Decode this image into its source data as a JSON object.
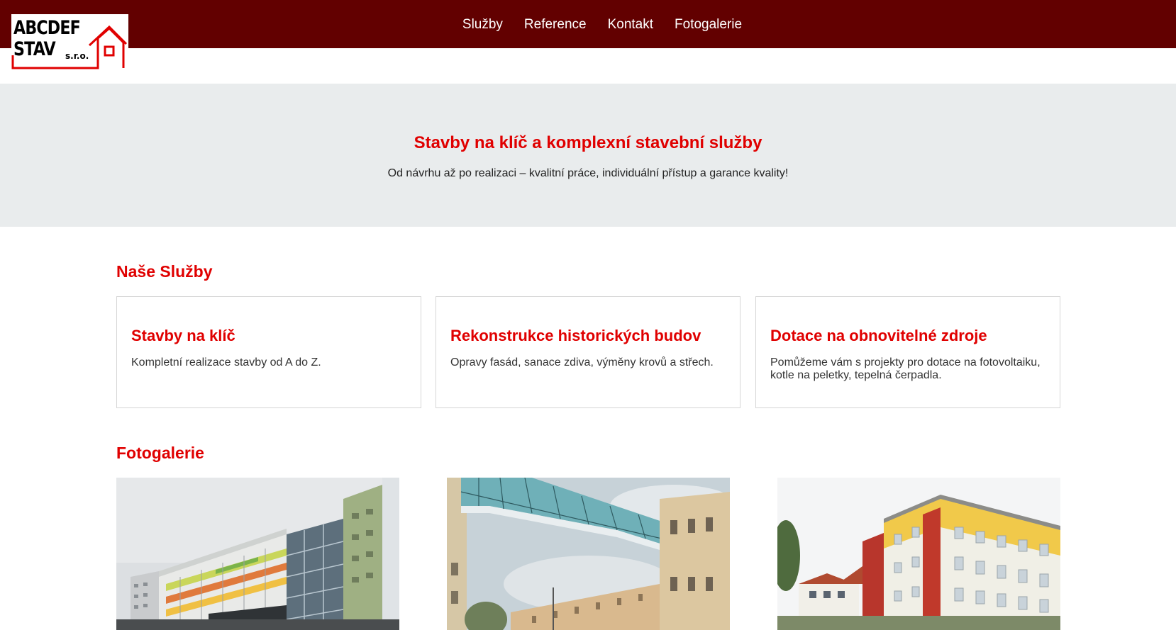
{
  "header": {
    "logo": {
      "line1": "ABCDEF",
      "line2": "STAV",
      "suffix": "s.r.o."
    },
    "nav": [
      {
        "label": "Služby"
      },
      {
        "label": "Reference"
      },
      {
        "label": "Kontakt"
      },
      {
        "label": "Fotogalerie"
      }
    ]
  },
  "hero": {
    "title": "Stavby na klíč a komplexní stavební služby",
    "subtitle": "Od návrhu až po realizaci – kvalitní práce, individuální přístup a garance kvality!"
  },
  "services": {
    "heading": "Naše Služby",
    "items": [
      {
        "title": "Stavby na klíč",
        "text": "Kompletní realizace stavby od A do Z."
      },
      {
        "title": "Rekonstrukce historických budov",
        "text": "Opravy fasád, sanace zdiva, výměny krovů a střech."
      },
      {
        "title": "Dotace na obnovitelné zdroje",
        "text": "Pomůžeme vám s projekty pro dotace na fotovoltaiku, kotle na peletky, tepelná čerpadla."
      }
    ]
  },
  "gallery": {
    "heading": "Fotogalerie",
    "photos": [
      {
        "subject": "modern-building-with-colored-balconies"
      },
      {
        "subject": "glass-skybridge-between-historic-buildings"
      },
      {
        "subject": "renovated-yellow-red-building"
      }
    ]
  },
  "colors": {
    "header_bg": "#620000",
    "accent": "#e00000",
    "hero_bg": "#e9eced",
    "logo_red": "#e00000"
  }
}
